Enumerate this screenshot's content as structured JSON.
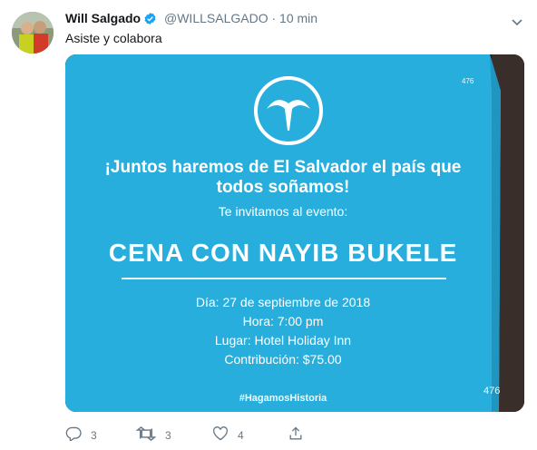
{
  "tweet": {
    "display_name": "Will Salgado",
    "handle": "@WILLSALGADO",
    "separator": "·",
    "time": "10 min",
    "text": "Asiste y colabora"
  },
  "invitation": {
    "number_top": "476",
    "tagline_line1": "¡Juntos haremos de El Salvador el país que",
    "tagline_line2": "todos soñamos!",
    "invite": "Te invitamos al evento:",
    "title": "CENA CON NAYIB BUKELE",
    "date": "Día: 27 de septiembre de 2018",
    "hour": "Hora: 7:00 pm",
    "place": "Lugar: Hotel Holiday Inn",
    "contribution": "Contribución: $75.00",
    "hashtag": "#HagamosHistoria",
    "number_bottom": "476"
  },
  "actions": {
    "replies": "3",
    "retweets": "3",
    "likes": "4"
  },
  "colors": {
    "card": "#27aedd",
    "verified": "#1da1f2",
    "muted": "#657786"
  },
  "icons": [
    "verified-badge-icon",
    "chevron-down-icon",
    "reply-icon",
    "retweet-icon",
    "like-icon",
    "share-icon"
  ]
}
